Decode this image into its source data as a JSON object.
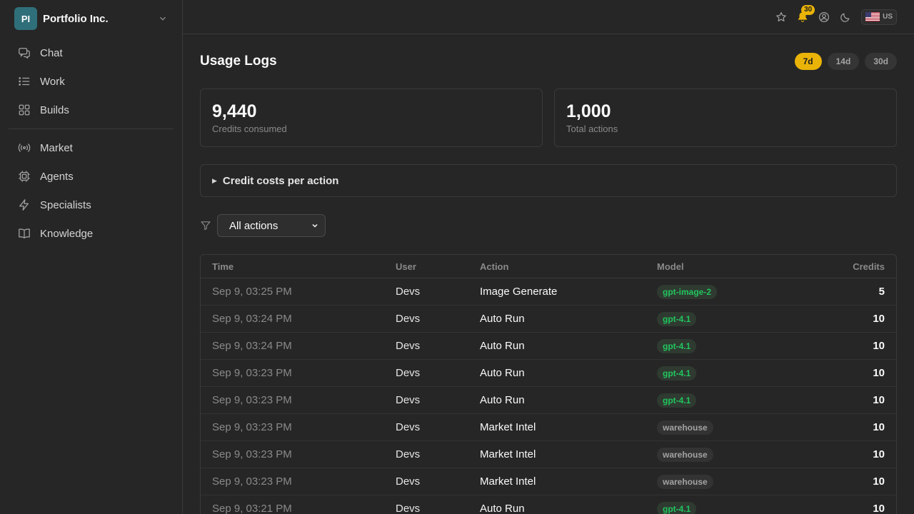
{
  "sidebar": {
    "org": {
      "initials": "PI",
      "name": "Portfolio Inc."
    },
    "items_top": [
      {
        "label": "Chat",
        "icon": "chat-icon"
      },
      {
        "label": "Work",
        "icon": "list-icon"
      },
      {
        "label": "Builds",
        "icon": "grid-icon"
      }
    ],
    "items_bottom": [
      {
        "label": "Market",
        "icon": "broadcast-icon"
      },
      {
        "label": "Agents",
        "icon": "cpu-icon"
      },
      {
        "label": "Specialists",
        "icon": "lightning-icon"
      },
      {
        "label": "Knowledge",
        "icon": "book-icon"
      }
    ]
  },
  "topbar": {
    "notifications_count": "30",
    "locale": "US"
  },
  "page": {
    "title": "Usage Logs",
    "ranges": [
      "7d",
      "14d",
      "30d"
    ],
    "active_range": "7d"
  },
  "stats": [
    {
      "value": "9,440",
      "label": "Credits consumed"
    },
    {
      "value": "1,000",
      "label": "Total actions"
    }
  ],
  "details": {
    "label": "Credit costs per action"
  },
  "filter": {
    "selected": "All actions"
  },
  "table": {
    "headers": {
      "time": "Time",
      "user": "User",
      "action": "Action",
      "model": "Model",
      "credits": "Credits"
    },
    "rows": [
      {
        "time": "Sep 9, 03:25 PM",
        "user": "Devs",
        "action": "Image Generate",
        "model": "gpt-image-2",
        "credits": "5"
      },
      {
        "time": "Sep 9, 03:24 PM",
        "user": "Devs",
        "action": "Auto Run",
        "model": "gpt-4.1",
        "credits": "10"
      },
      {
        "time": "Sep 9, 03:24 PM",
        "user": "Devs",
        "action": "Auto Run",
        "model": "gpt-4.1",
        "credits": "10"
      },
      {
        "time": "Sep 9, 03:23 PM",
        "user": "Devs",
        "action": "Auto Run",
        "model": "gpt-4.1",
        "credits": "10"
      },
      {
        "time": "Sep 9, 03:23 PM",
        "user": "Devs",
        "action": "Auto Run",
        "model": "gpt-4.1",
        "credits": "10"
      },
      {
        "time": "Sep 9, 03:23 PM",
        "user": "Devs",
        "action": "Market Intel",
        "model": "warehouse",
        "credits": "10"
      },
      {
        "time": "Sep 9, 03:23 PM",
        "user": "Devs",
        "action": "Market Intel",
        "model": "warehouse",
        "credits": "10"
      },
      {
        "time": "Sep 9, 03:23 PM",
        "user": "Devs",
        "action": "Market Intel",
        "model": "warehouse",
        "credits": "10"
      },
      {
        "time": "Sep 9, 03:21 PM",
        "user": "Devs",
        "action": "Auto Run",
        "model": "gpt-4.1",
        "credits": "10"
      }
    ]
  },
  "colors": {
    "accent": "#eab308",
    "model_green": "#22c55e",
    "avatar": "#2f6f7a"
  }
}
